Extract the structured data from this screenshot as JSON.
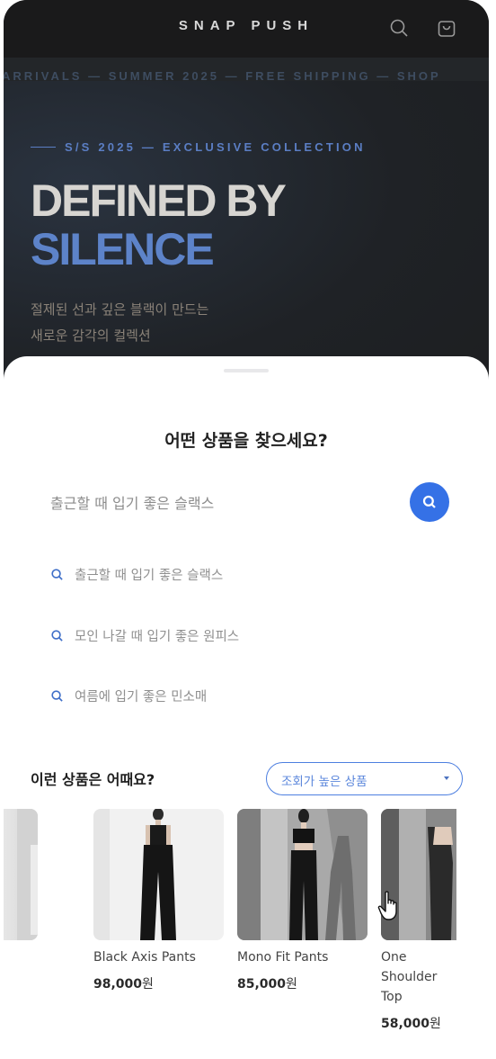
{
  "store": {
    "brand": "SNAP PUSH",
    "marquee": "ARRIVALS — SUMMER 2025 — FREE SHIPPING — SHOP",
    "hero": {
      "eyebrow": "S/S 2025 — EXCLUSIVE COLLECTION",
      "title_line1": "DEFINED BY",
      "title_line2": "SILENCE",
      "desc_line1": "절제된 선과 깊은 블랙이 만드는",
      "desc_line2": "새로운 감각의 컬렉션"
    },
    "icons": {
      "search": "search-icon",
      "bag": "shopping-bag-icon"
    }
  },
  "sheet": {
    "title": "어떤 상품을 찾으세요?",
    "search": {
      "value": "출근할 때 입기 좋은 슬랙스",
      "button_icon": "search-icon"
    },
    "suggestions": [
      "출근할 때 입기 좋은 슬랙스",
      "모인 나갈 때 입기 좋은 원피스",
      "여름에 입기 좋은 민소매"
    ],
    "recommend": {
      "title": "이런 상품은 어때요?",
      "sort_selected": "조회가 높은 상품",
      "products": [
        {
          "name": "",
          "price": ""
        },
        {
          "name": "Black Axis Pants",
          "price": "98,000",
          "currency": "원"
        },
        {
          "name": "Mono Fit Pants",
          "price": "85,000",
          "currency": "원"
        },
        {
          "name": "One Shoulder Top",
          "price": "58,000",
          "currency": "원"
        }
      ]
    }
  },
  "colors": {
    "accent": "#3571e6",
    "hero_blue": "#5d83c9",
    "dark_bg": "#1d1e20"
  }
}
